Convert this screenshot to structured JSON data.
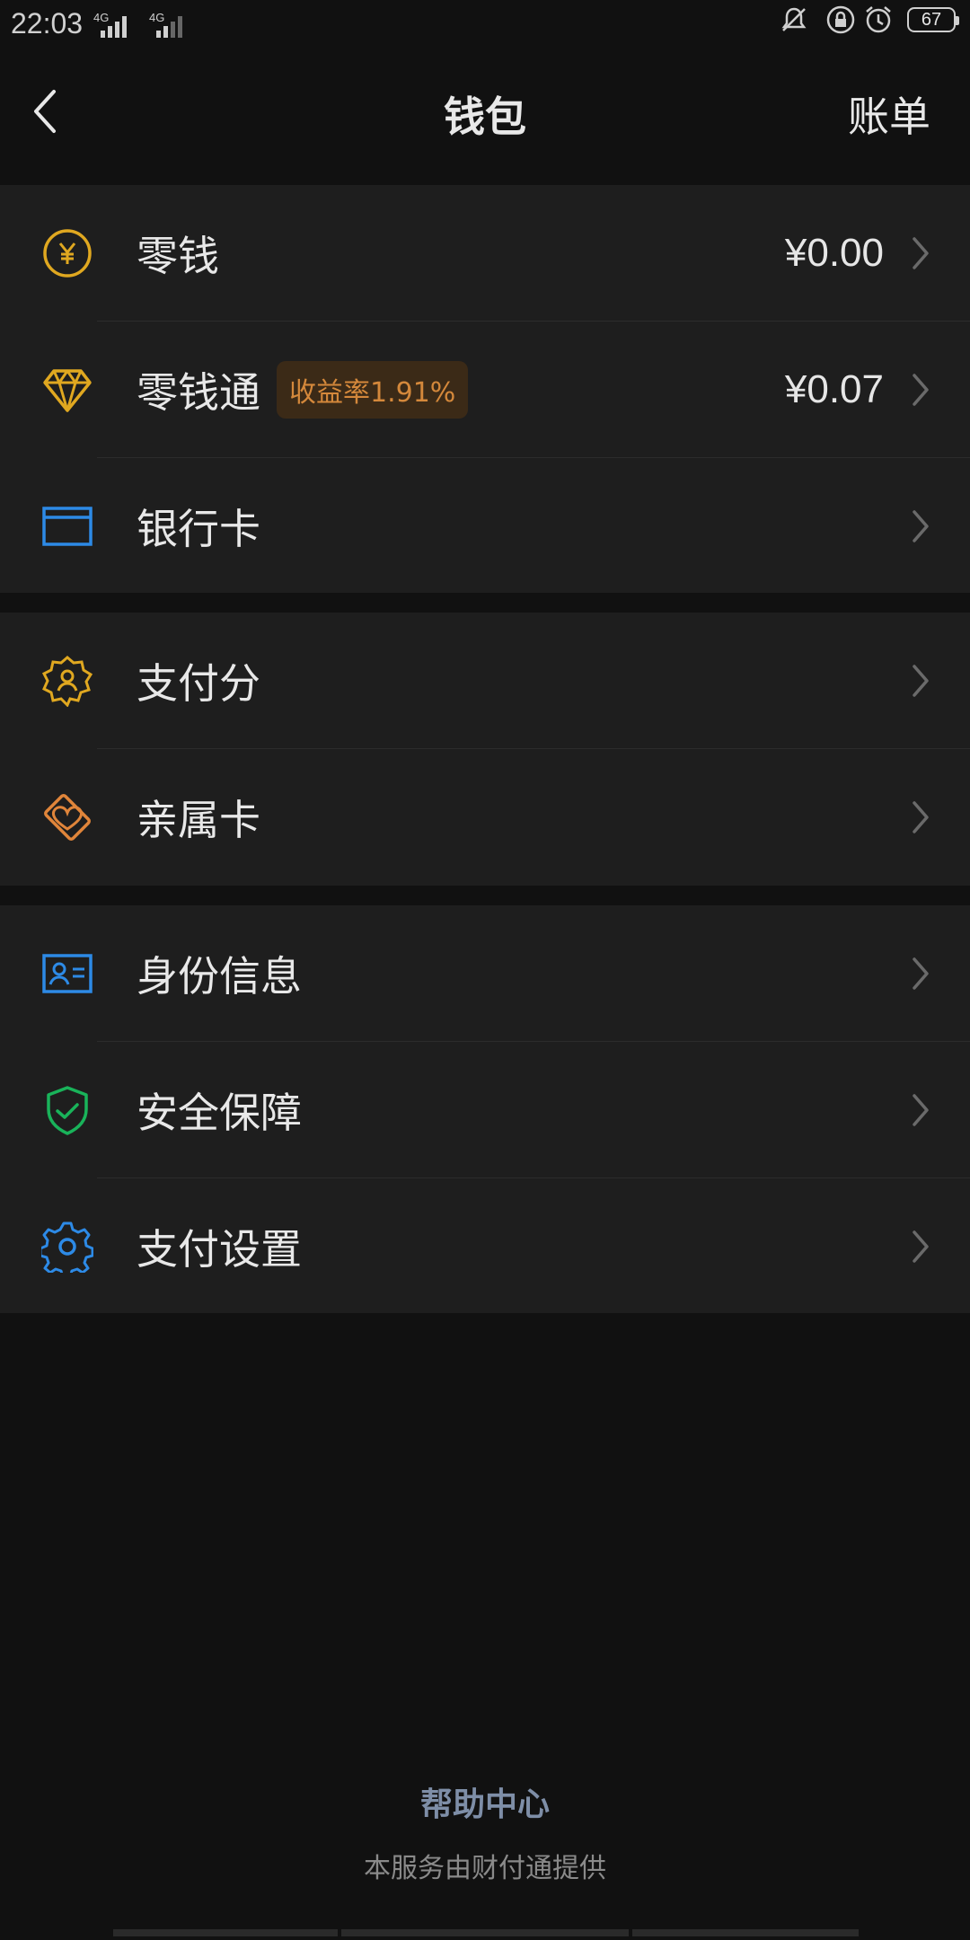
{
  "status_bar": {
    "time": "22:03",
    "signal1_label": "4G",
    "signal2_label": "4G",
    "battery": "67"
  },
  "nav": {
    "title": "钱包",
    "right_action": "账单"
  },
  "groups": [
    {
      "items": [
        {
          "label": "零钱",
          "value": "¥0.00",
          "icon": "coin-yuan-icon"
        },
        {
          "label": "零钱通",
          "badge": "收益率1.91%",
          "value": "¥0.07",
          "icon": "diamond-icon"
        },
        {
          "label": "银行卡",
          "icon": "bank-card-icon"
        }
      ]
    },
    {
      "items": [
        {
          "label": "支付分",
          "icon": "credit-score-icon"
        },
        {
          "label": "亲属卡",
          "icon": "family-card-icon"
        }
      ]
    },
    {
      "items": [
        {
          "label": "身份信息",
          "icon": "id-card-icon"
        },
        {
          "label": "安全保障",
          "icon": "shield-check-icon"
        },
        {
          "label": "支付设置",
          "icon": "gear-icon"
        }
      ]
    }
  ],
  "footer": {
    "help": "帮助中心",
    "provider": "本服务由财付通提供"
  },
  "colors": {
    "background": "#111111",
    "card": "#1e1e1e",
    "yellow_icon": "#e0a820",
    "blue_icon": "#2d8ae6",
    "orange_icon": "#e0853a",
    "green_icon": "#19b35a",
    "badge_bg": "#3b2a17",
    "badge_text": "#d4883b",
    "help_text": "#7e8ea7"
  }
}
